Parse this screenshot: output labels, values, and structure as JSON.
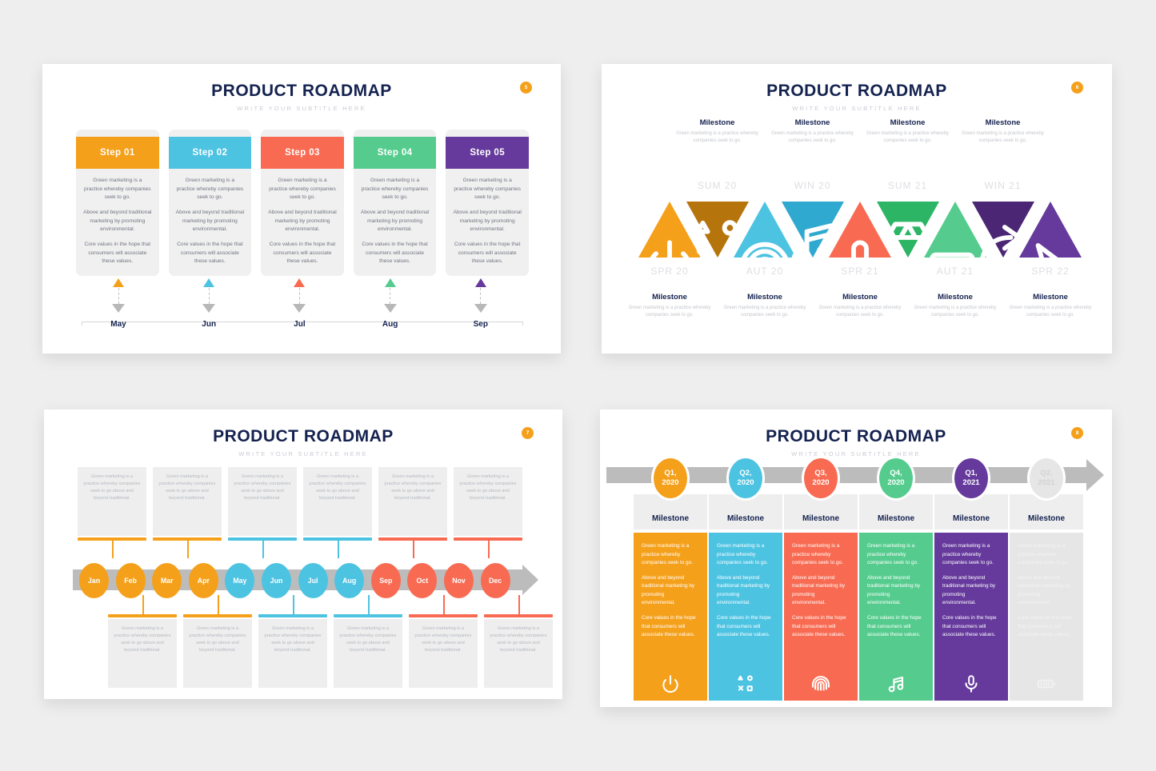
{
  "common": {
    "title": "PRODUCT ROADMAP",
    "subtitle": "WRITE YOUR SUBTITLE HERE",
    "body_p1": "Green marketing is a practice whereby companies seek to go.",
    "body_p2": "Above and beyond traditional marketing by promoting environmental.",
    "body_p3": "Core values in the hope that consumers will associate these values.",
    "milestone_label": "Milestone",
    "milestone_desc": "Green marketing is a practice whereby companies seek to go.",
    "small_desc": "Green marketing is a practice whereby companies seek to go above and beyond traditional.",
    "colors": {
      "orange": "#f5a01b",
      "cyan": "#4dc3e2",
      "coral": "#f86b52",
      "green": "#55cc8e",
      "purple": "#653a9c",
      "purple_dark": "#4b2675",
      "orange_dark": "#b5740c",
      "cyan_dark": "#2fa9cf",
      "green_dark": "#2cb565",
      "gray": "#e6e6e6",
      "navy": "#14224f",
      "track": "#bcbcbc"
    }
  },
  "slide1": {
    "page": "5",
    "steps": [
      {
        "label": "Step 01",
        "color": "#f5a01b",
        "month": "May"
      },
      {
        "label": "Step 02",
        "color": "#4dc3e2",
        "month": "Jun"
      },
      {
        "label": "Step 03",
        "color": "#f86b52",
        "month": "Jul"
      },
      {
        "label": "Step 04",
        "color": "#55cc8e",
        "month": "Aug"
      },
      {
        "label": "Step 05",
        "color": "#653a9c",
        "month": "Sep"
      }
    ]
  },
  "slide2": {
    "page": "6",
    "top_notes": [
      {
        "title": "Milestone",
        "desc": "Green marketing is a practice whereby companies seek to go."
      },
      {
        "title": "Milestone",
        "desc": "Green marketing is a practice whereby companies seek to go."
      },
      {
        "title": "Milestone",
        "desc": "Green marketing is a practice whereby companies seek to go."
      },
      {
        "title": "Milestone",
        "desc": "Green marketing is a practice whereby companies seek to go."
      }
    ],
    "bottom_notes": [
      {
        "title": "Milestone",
        "desc": "Green marketing is a practice whereby companies seek to go."
      },
      {
        "title": "Milestone",
        "desc": "Green marketing is a practice whereby companies seek to go."
      },
      {
        "title": "Milestone",
        "desc": "Green marketing is a practice whereby companies seek to go."
      },
      {
        "title": "Milestone",
        "desc": "Green marketing is a practice whereby companies seek to go."
      },
      {
        "title": "Milestone",
        "desc": "Green marketing is a practice whereby companies seek to go."
      }
    ],
    "seasons_top": [
      "SUM 20",
      "WIN 20",
      "SUM 21",
      "WIN 21"
    ],
    "seasons_bottom": [
      "SPR 20",
      "AUT 20",
      "SPR 21",
      "AUT 21",
      "SPR 22"
    ],
    "triangles": [
      {
        "dir": "up",
        "color": "#f5a01b",
        "icon": "power-icon"
      },
      {
        "dir": "down",
        "color": "#b5740c",
        "icon": "gamepad-shapes-icon"
      },
      {
        "dir": "up",
        "color": "#4dc3e2",
        "icon": "fingerprint-icon"
      },
      {
        "dir": "down",
        "color": "#2fa9cf",
        "icon": "music-note-icon"
      },
      {
        "dir": "up",
        "color": "#f86b52",
        "icon": "microphone-icon"
      },
      {
        "dir": "down",
        "color": "#2cb565",
        "icon": "diamond-icon"
      },
      {
        "dir": "up",
        "color": "#55cc8e",
        "icon": "battery-icon"
      },
      {
        "dir": "down",
        "color": "#4b2675",
        "icon": "share-arrow-icon"
      },
      {
        "dir": "up",
        "color": "#653a9c",
        "icon": "cursor-icon"
      }
    ]
  },
  "slide3": {
    "page": "7",
    "months": [
      {
        "label": "Jan",
        "color": "#f5a01b"
      },
      {
        "label": "Feb",
        "color": "#f5a01b"
      },
      {
        "label": "Mar",
        "color": "#f5a01b"
      },
      {
        "label": "Apr",
        "color": "#f5a01b"
      },
      {
        "label": "May",
        "color": "#4dc3e2"
      },
      {
        "label": "Jun",
        "color": "#4dc3e2"
      },
      {
        "label": "Jul",
        "color": "#4dc3e2"
      },
      {
        "label": "Aug",
        "color": "#4dc3e2"
      },
      {
        "label": "Sep",
        "color": "#f86b52"
      },
      {
        "label": "Oct",
        "color": "#f86b52"
      },
      {
        "label": "Nov",
        "color": "#f86b52"
      },
      {
        "label": "Dec",
        "color": "#f86b52"
      }
    ],
    "top_cards": [
      {
        "color": "#f5a01b",
        "text": "Green marketing is a practice whereby companies seek to go above and beyond traditional."
      },
      {
        "color": "#f5a01b",
        "text": "Green marketing is a practice whereby companies seek to go above and beyond traditional."
      },
      {
        "color": "#4dc3e2",
        "text": "Green marketing is a practice whereby companies seek to go above and beyond traditional."
      },
      {
        "color": "#4dc3e2",
        "text": "Green marketing is a practice whereby companies seek to go above and beyond traditional."
      },
      {
        "color": "#f86b52",
        "text": "Green marketing is a practice whereby companies seek to go above and beyond traditional."
      },
      {
        "color": "#f86b52",
        "text": "Green marketing is a practice whereby companies seek to go above and beyond traditional."
      }
    ],
    "bottom_cards": [
      {
        "color": "#f5a01b",
        "text": "Green marketing is a practice whereby companies seek to go above and beyond traditional."
      },
      {
        "color": "#f5a01b",
        "text": "Green marketing is a practice whereby companies seek to go above and beyond traditional."
      },
      {
        "color": "#4dc3e2",
        "text": "Green marketing is a practice whereby companies seek to go above and beyond traditional."
      },
      {
        "color": "#4dc3e2",
        "text": "Green marketing is a practice whereby companies seek to go above and beyond traditional."
      },
      {
        "color": "#f86b52",
        "text": "Green marketing is a practice whereby companies seek to go above and beyond traditional."
      },
      {
        "color": "#f86b52",
        "text": "Green marketing is a practice whereby companies seek to go above and beyond traditional."
      }
    ]
  },
  "slide4": {
    "page": "8",
    "quarters": [
      {
        "q": "Q1,",
        "year": "2020",
        "color": "#f5a01b",
        "label": "Milestone",
        "icon": "power-icon",
        "dim": false
      },
      {
        "q": "Q2,",
        "year": "2020",
        "color": "#4dc3e2",
        "label": "Milestone",
        "icon": "gamepad-shapes-icon",
        "dim": false
      },
      {
        "q": "Q3,",
        "year": "2020",
        "color": "#f86b52",
        "label": "Milestone",
        "icon": "fingerprint-icon",
        "dim": false
      },
      {
        "q": "Q4,",
        "year": "2020",
        "color": "#55cc8e",
        "label": "Milestone",
        "icon": "music-note-icon",
        "dim": false
      },
      {
        "q": "Q1,",
        "year": "2021",
        "color": "#653a9c",
        "label": "Milestone",
        "icon": "microphone-icon",
        "dim": false
      },
      {
        "q": "Q2,",
        "year": "2021",
        "color": "#e6e6e6",
        "label": "Milestone",
        "icon": "battery-icon",
        "dim": true
      }
    ]
  }
}
